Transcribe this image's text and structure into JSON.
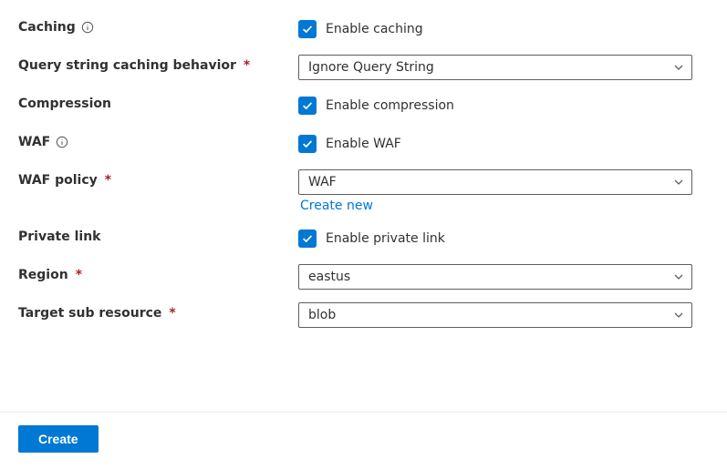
{
  "fields": {
    "caching": {
      "label": "Caching",
      "has_info": true,
      "checkbox_label": "Enable caching",
      "checked": true
    },
    "query_string": {
      "label": "Query string caching behavior",
      "required": true,
      "value": "Ignore Query String"
    },
    "compression": {
      "label": "Compression",
      "checkbox_label": "Enable compression",
      "checked": true
    },
    "waf": {
      "label": "WAF",
      "has_info": true,
      "checkbox_label": "Enable WAF",
      "checked": true
    },
    "waf_policy": {
      "label": "WAF policy",
      "required": true,
      "value": "WAF",
      "link": "Create new"
    },
    "private_link": {
      "label": "Private link",
      "checkbox_label": "Enable private link",
      "checked": true
    },
    "region": {
      "label": "Region",
      "required": true,
      "value": "eastus"
    },
    "target_sub": {
      "label": "Target sub resource",
      "required": true,
      "value": "blob"
    }
  },
  "footer": {
    "create": "Create"
  }
}
